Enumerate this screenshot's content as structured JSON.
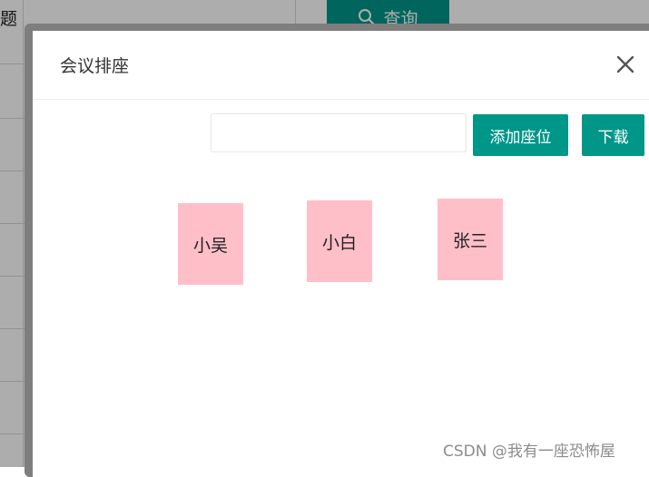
{
  "background": {
    "header_fragment": "题",
    "query_button_label": "查询",
    "icons": {
      "query": "search-icon"
    }
  },
  "modal": {
    "title": "会议排座",
    "close_icon": "close-icon",
    "input": {
      "value": "",
      "placeholder": ""
    },
    "add_seat_label": "添加座位",
    "download_label": "下载",
    "seats": [
      {
        "name": "小吴"
      },
      {
        "name": "小白"
      },
      {
        "name": "张三"
      }
    ],
    "watermark": "CSDN @我有一座恐怖屋"
  },
  "colors": {
    "primary": "#009688",
    "seat": "#ffbfc9",
    "overlay": "rgba(0,0,0,0.32)"
  }
}
